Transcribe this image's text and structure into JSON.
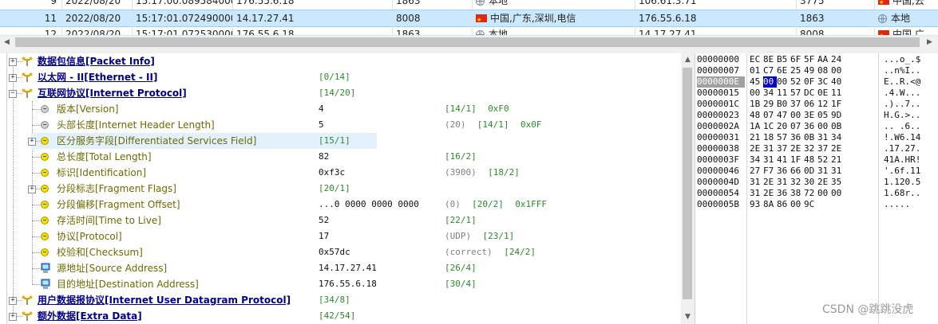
{
  "packet_list": {
    "rows": [
      {
        "no": "9",
        "date": "2022/08/20",
        "time": "15:17:00.089584000",
        "src": "176.55.6.18",
        "len": "1863",
        "loc": "本地",
        "loc_flag": false,
        "dst": "106.61.3.71",
        "dlen": "3775",
        "dloc": "中国,云",
        "dloc_flag": true,
        "selected": false
      },
      {
        "no": "11",
        "date": "2022/08/20",
        "time": "15:17:01.072490000",
        "src": "14.17.27.41",
        "len": "8008",
        "loc": "中国,广东,深圳,电信",
        "loc_flag": true,
        "dst": "176.55.6.18",
        "dlen": "1863",
        "dloc": "本地",
        "dloc_flag": false,
        "selected": true
      },
      {
        "no": "12",
        "date": "2022/08/20",
        "time": "15:17:01.072530000",
        "src": "176.55.6.18",
        "len": "1863",
        "loc": "本地",
        "loc_flag": false,
        "dst": "14.17.27.41",
        "dlen": "8008",
        "dloc": "中国,广",
        "dloc_flag": true,
        "selected": false
      }
    ]
  },
  "tree": {
    "nodes": [
      {
        "label": "数据包信息[Packet Info]",
        "kind": "top",
        "expander": "+",
        "value": "",
        "meta": "",
        "range": ""
      },
      {
        "label": "以太网 - II[Ethernet - II]",
        "kind": "top",
        "expander": "+",
        "value": "",
        "meta": "",
        "range": "[0/14]"
      },
      {
        "label": "互联网协议[Internet Protocol]",
        "kind": "top",
        "expander": "-",
        "value": "",
        "meta": "",
        "range": "[14/20]"
      },
      {
        "label": "版本[Version]",
        "kind": "gray",
        "value": "4",
        "meta": "",
        "range": "[14/1]",
        "hex": "0xF0"
      },
      {
        "label": "头部长度[Internet Header Length]",
        "kind": "gray",
        "value": "5",
        "meta": "(20)",
        "range": "[14/1]",
        "hex": "0x0F"
      },
      {
        "label": "区分服务字段[Differentiated Services Field]",
        "kind": "yellow",
        "expander": "+",
        "value": "",
        "meta": "",
        "range": "[15/1]",
        "highlight": true
      },
      {
        "label": "总长度[Total Length]",
        "kind": "yellow",
        "value": "82",
        "meta": "",
        "range": "[16/2]"
      },
      {
        "label": "标识[Identification]",
        "kind": "yellow",
        "value": "0xf3c",
        "meta": "(3900)",
        "range": "[18/2]"
      },
      {
        "label": "分段标志[Fragment Flags]",
        "kind": "yellow",
        "expander": "+",
        "value": "",
        "meta": "",
        "range": "[20/1]"
      },
      {
        "label": "分段偏移[Fragment Offset]",
        "kind": "yellow",
        "value": "...0 0000 0000 0000",
        "meta": "(0)",
        "range": "[20/2]",
        "hex": "0x1FFF"
      },
      {
        "label": "存活时间[Time to Live]",
        "kind": "yellow",
        "value": "52",
        "meta": "",
        "range": "[22/1]"
      },
      {
        "label": "协议[Protocol]",
        "kind": "yellow",
        "value": "17",
        "meta": "(UDP)",
        "range": "[23/1]"
      },
      {
        "label": "校验和[Checksum]",
        "kind": "yellow",
        "value": "0x57dc",
        "meta": "(correct)",
        "range": "[24/2]"
      },
      {
        "label": "源地址[Source Address]",
        "kind": "pc",
        "value": "14.17.27.41",
        "meta": "",
        "range": "[26/4]"
      },
      {
        "label": "目的地址[Destination Address]",
        "kind": "pc",
        "value": "176.55.6.18",
        "meta": "",
        "range": "[30/4]"
      },
      {
        "label": "用户数据报协议[Internet User Datagram Protocol]",
        "kind": "top",
        "expander": "+",
        "value": "",
        "meta": "",
        "range": "[34/8]"
      },
      {
        "label": "额外数据[Extra Data]",
        "kind": "top",
        "expander": "+",
        "value": "",
        "meta": "",
        "range": "[42/54]"
      }
    ]
  },
  "hex": {
    "rows": [
      {
        "offset": "00000000",
        "bytes": [
          "EC",
          "8E",
          "B5",
          "6F",
          "5F",
          "AA",
          "24"
        ],
        "ascii": "...o_.$",
        "sel_offset": false
      },
      {
        "offset": "00000007",
        "bytes": [
          "01",
          "C7",
          "6E",
          "25",
          "49",
          "08",
          "00"
        ],
        "ascii": "..n%I..",
        "sel_offset": false
      },
      {
        "offset": "0000000E",
        "bytes": [
          "45",
          "00",
          "00",
          "52",
          "0F",
          "3C",
          "40"
        ],
        "ascii": "E..R.<@",
        "sel_offset": true,
        "sel_byte": 1
      },
      {
        "offset": "00000015",
        "bytes": [
          "00",
          "34",
          "11",
          "57",
          "DC",
          "0E",
          "11"
        ],
        "ascii": ".4.W...",
        "sel_offset": false
      },
      {
        "offset": "0000001C",
        "bytes": [
          "1B",
          "29",
          "B0",
          "37",
          "06",
          "12",
          "1F"
        ],
        "ascii": ".)..7..",
        "sel_offset": false
      },
      {
        "offset": "00000023",
        "bytes": [
          "48",
          "07",
          "47",
          "00",
          "3E",
          "05",
          "9D"
        ],
        "ascii": "H.G.>..",
        "sel_offset": false
      },
      {
        "offset": "0000002A",
        "bytes": [
          "1A",
          "1C",
          "20",
          "07",
          "36",
          "00",
          "0B"
        ],
        "ascii": ".. .6..",
        "sel_offset": false
      },
      {
        "offset": "00000031",
        "bytes": [
          "21",
          "18",
          "57",
          "36",
          "0B",
          "31",
          "34"
        ],
        "ascii": "!.W6.14",
        "sel_offset": false
      },
      {
        "offset": "00000038",
        "bytes": [
          "2E",
          "31",
          "37",
          "2E",
          "32",
          "37",
          "2E"
        ],
        "ascii": ".17.27.",
        "sel_offset": false
      },
      {
        "offset": "0000003F",
        "bytes": [
          "34",
          "31",
          "41",
          "1F",
          "48",
          "52",
          "21"
        ],
        "ascii": "41A.HR!",
        "sel_offset": false
      },
      {
        "offset": "00000046",
        "bytes": [
          "27",
          "F7",
          "36",
          "66",
          "0D",
          "31",
          "31"
        ],
        "ascii": "'.6f.11",
        "sel_offset": false
      },
      {
        "offset": "0000004D",
        "bytes": [
          "31",
          "2E",
          "31",
          "32",
          "30",
          "2E",
          "35"
        ],
        "ascii": "1.120.5",
        "sel_offset": false
      },
      {
        "offset": "00000054",
        "bytes": [
          "31",
          "2E",
          "36",
          "38",
          "72",
          "00",
          "00"
        ],
        "ascii": "1.68r..",
        "sel_offset": false
      },
      {
        "offset": "0000005B",
        "bytes": [
          "93",
          "8A",
          "86",
          "00",
          "9C"
        ],
        "ascii": ".....",
        "sel_offset": false
      }
    ]
  },
  "watermark": "CSDN @跳跳没虎"
}
